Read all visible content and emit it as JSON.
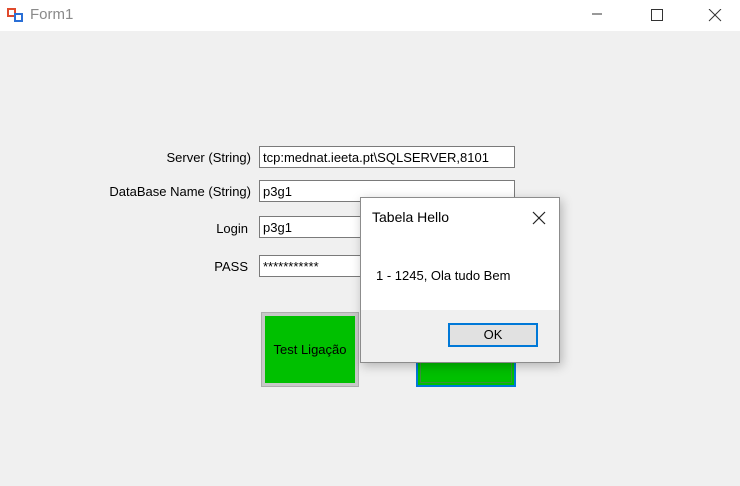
{
  "window": {
    "title": "Form1",
    "icon": "winforms-app-icon",
    "controls": {
      "minimize": "minimize-icon",
      "maximize": "maximize-icon",
      "close": "close-icon"
    }
  },
  "form": {
    "fields": [
      {
        "label": "Server (String)",
        "value": "tcp:mednat.ieeta.pt\\SQLSERVER,8101"
      },
      {
        "label": "DataBase Name (String)",
        "value": "p3g1"
      },
      {
        "label": "Login",
        "value": "p3g1"
      },
      {
        "label": "PASS",
        "value": "***********"
      }
    ],
    "buttons": {
      "test_label": "Test Ligação",
      "second_label": ""
    },
    "button_color": "#00c000"
  },
  "dialog": {
    "title": "Tabela Hello",
    "message": "1 - 1245, Ola tudo Bem",
    "ok_label": "OK",
    "accent_color": "#0078d7"
  }
}
